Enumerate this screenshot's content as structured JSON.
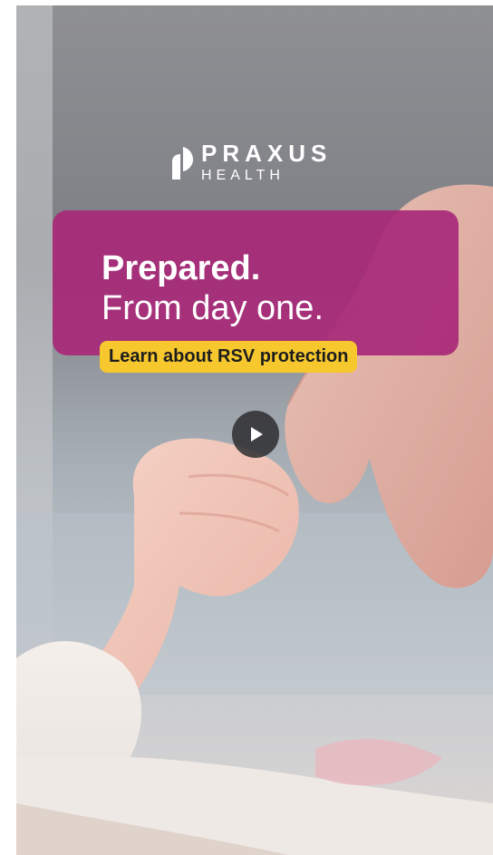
{
  "brand": {
    "name_top": "PRAXUS",
    "name_bottom": "HEALTH",
    "logo_icon": "praxus-logo-mark"
  },
  "promo": {
    "headline": "Prepared.",
    "subline": "From day one.",
    "cta_label": "Learn about RSV protection"
  },
  "video": {
    "play_icon": "play-icon"
  },
  "colors": {
    "promo_background": "#a82a78",
    "cta_background": "#f7c82e",
    "cta_text": "#1d1d1d",
    "play_button": "#2d2d30"
  }
}
